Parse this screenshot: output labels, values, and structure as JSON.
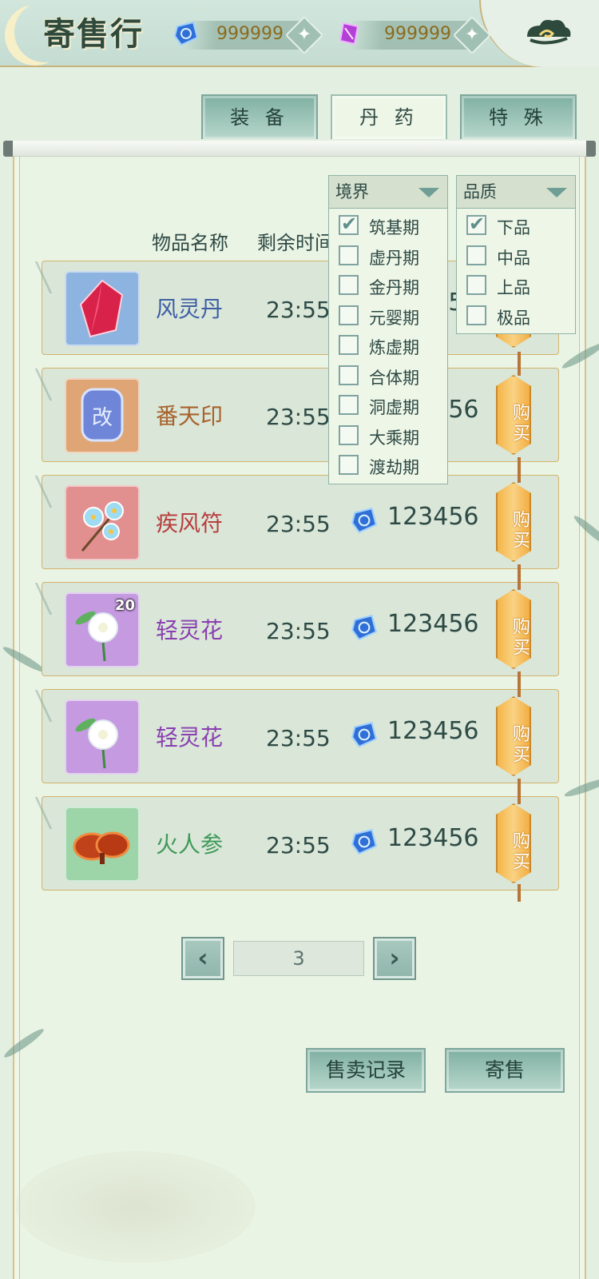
{
  "header": {
    "title": "寄售行",
    "currency_blue": "999999",
    "currency_purple": "999999",
    "plus_symbol": "✦",
    "icons": [
      "moon-icon",
      "blue-gem-icon",
      "purple-gem-icon",
      "plus-icon",
      "cloud-icon"
    ]
  },
  "tabs": [
    {
      "label": "装 备",
      "active": false
    },
    {
      "label": "丹 药",
      "active": true
    },
    {
      "label": "特 殊",
      "active": false
    }
  ],
  "columns": {
    "name": "物品名称",
    "time": "剩余时间"
  },
  "items": [
    {
      "name": "风灵丹",
      "time": "23:55",
      "price": "123456",
      "color": "#3e5fa3",
      "icon": "red-crystal-icon",
      "bg": "#8db3e0",
      "badge": ""
    },
    {
      "name": "番天印",
      "time": "23:55",
      "price": "123456",
      "color": "#a8622c",
      "icon": "seal-icon",
      "bg": "#e0a574",
      "badge": ""
    },
    {
      "name": "疾风符",
      "time": "23:55",
      "price": "123456",
      "color": "#b83e3e",
      "icon": "blue-flower-icon",
      "bg": "#e28f8f",
      "badge": ""
    },
    {
      "name": "轻灵花",
      "time": "23:55",
      "price": "123456",
      "color": "#8a3fb0",
      "icon": "white-flower-icon",
      "bg": "#c59ae0",
      "badge": "20"
    },
    {
      "name": "轻灵花",
      "time": "23:55",
      "price": "123456",
      "color": "#8a3fb0",
      "icon": "white-flower-icon",
      "bg": "#c59ae0",
      "badge": ""
    },
    {
      "name": "火人参",
      "time": "23:55",
      "price": "123456",
      "color": "#3f9a58",
      "icon": "lingzhi-icon",
      "bg": "#9dd4a8",
      "badge": ""
    }
  ],
  "buy_label": "购买",
  "filters": {
    "realm": {
      "label": "境界",
      "options": [
        {
          "label": "筑基期",
          "checked": true
        },
        {
          "label": "虚丹期",
          "checked": false
        },
        {
          "label": "金丹期",
          "checked": false
        },
        {
          "label": "元婴期",
          "checked": false
        },
        {
          "label": "炼虚期",
          "checked": false
        },
        {
          "label": "合体期",
          "checked": false
        },
        {
          "label": "洞虚期",
          "checked": false
        },
        {
          "label": "大乘期",
          "checked": false
        },
        {
          "label": "渡劫期",
          "checked": false
        }
      ]
    },
    "quality": {
      "label": "品质",
      "options": [
        {
          "label": "下品",
          "checked": true
        },
        {
          "label": "中品",
          "checked": false
        },
        {
          "label": "上品",
          "checked": false
        },
        {
          "label": "极品",
          "checked": false
        }
      ]
    }
  },
  "pagination": {
    "prev": "‹",
    "next": "›",
    "page": "3"
  },
  "buttons": {
    "records": "售卖记录",
    "consign": "寄售"
  },
  "colors": {
    "accent_gold": "#d2b36b",
    "panel_bg": "#eaf4e4",
    "tab_teal": "#7fb0a2",
    "buy_orange": "#f5b54a"
  }
}
